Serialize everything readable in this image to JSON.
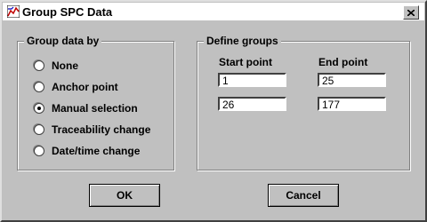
{
  "window": {
    "title": "Group SPC Data"
  },
  "group_by": {
    "title": "Group data by",
    "options": [
      {
        "label": "None",
        "selected": false
      },
      {
        "label": "Anchor point",
        "selected": false
      },
      {
        "label": "Manual selection",
        "selected": true
      },
      {
        "label": "Traceability change",
        "selected": false
      },
      {
        "label": "Date/time change",
        "selected": false
      }
    ]
  },
  "define_groups": {
    "title": "Define groups",
    "start_label": "Start point",
    "end_label": "End point",
    "rows": [
      {
        "start": "1",
        "end": "25"
      },
      {
        "start": "26",
        "end": "177"
      }
    ]
  },
  "buttons": {
    "ok": "OK",
    "cancel": "Cancel"
  }
}
